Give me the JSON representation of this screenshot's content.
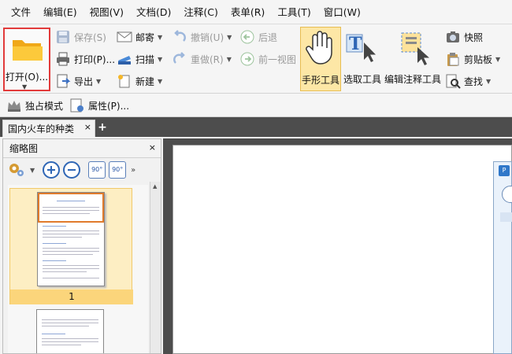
{
  "menu": [
    "文件",
    "编辑(E)",
    "视图(V)",
    "文档(D)",
    "注释(C)",
    "表单(R)",
    "工具(T)",
    "窗口(W)"
  ],
  "ribbon": {
    "open": "打开(O)...",
    "save": "保存(S)",
    "print": "打印(P)...",
    "export": "导出",
    "mail": "邮寄",
    "scan": "扫描",
    "new": "新建",
    "undo": "撤销(U)",
    "redo": "重做(R)",
    "back": "后退",
    "prev_view": "前一视图",
    "hand_tool": "手形工具",
    "select_tool": "选取工具",
    "edit_annot_tool": "编辑注释工具",
    "snapshot": "快照",
    "clipboard": "剪贴板",
    "find": "查找"
  },
  "bar2": {
    "exclusive_mode": "独占模式",
    "properties": "属性(P)..."
  },
  "tab": {
    "title": "国内火车的种类",
    "close": "×",
    "new": "+"
  },
  "panel": {
    "title": "缩略图",
    "close": "×",
    "page_number": "1",
    "rotate_left": "90°",
    "rotate_right": "90°"
  },
  "colors": {
    "highlight_border": "#e23b3b",
    "active_tool": "#fde7a6",
    "tab_bar": "#4d4d4d",
    "thumb_selected": "#fbd57b"
  }
}
